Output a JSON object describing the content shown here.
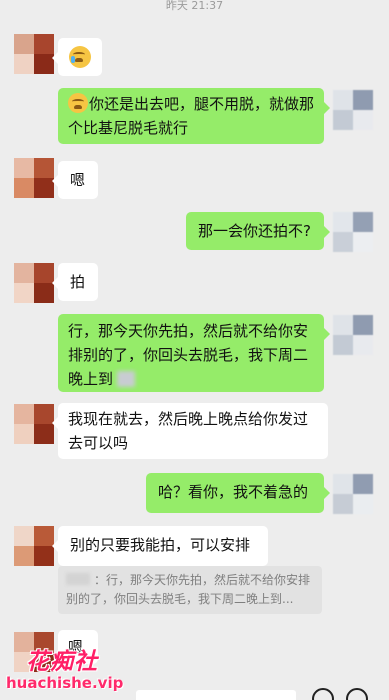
{
  "header": {
    "timestamp": "昨天 21:37"
  },
  "messages": [
    {
      "side": "left",
      "emoji": "crying-face-emoji",
      "text": ""
    },
    {
      "side": "right",
      "emoji": "grimacing-face-emoji",
      "text": "你还是出去吧，腿不用脱，就做那个比基尼脱毛就行"
    },
    {
      "side": "left",
      "text": "嗯"
    },
    {
      "side": "right",
      "text": "那一会你还拍不?"
    },
    {
      "side": "left",
      "text": "拍"
    },
    {
      "side": "right",
      "text": "行，那今天你先拍，然后就不给你安排别的了，你回头去脱毛，我下周二晚上到"
    },
    {
      "side": "left",
      "text": "我现在就去，然后晚上晚点给你发过去可以吗"
    },
    {
      "side": "right",
      "text": "哈？看你，我不着急的"
    },
    {
      "side": "left",
      "text": "别的只要我能拍，可以安排"
    },
    {
      "side": "left",
      "text": "嗯"
    }
  ],
  "quote": {
    "text": "：行，那今天你先拍，然后就不给你安排别的了，你回头去脱毛，我下周二晚上到..."
  },
  "watermark": {
    "title": "花痴社",
    "url": "huachishe.vip"
  },
  "colors": {
    "background": "#ededed",
    "incoming_bubble": "#ffffff",
    "outgoing_bubble": "#95ec69",
    "watermark": "#ff1f66"
  }
}
